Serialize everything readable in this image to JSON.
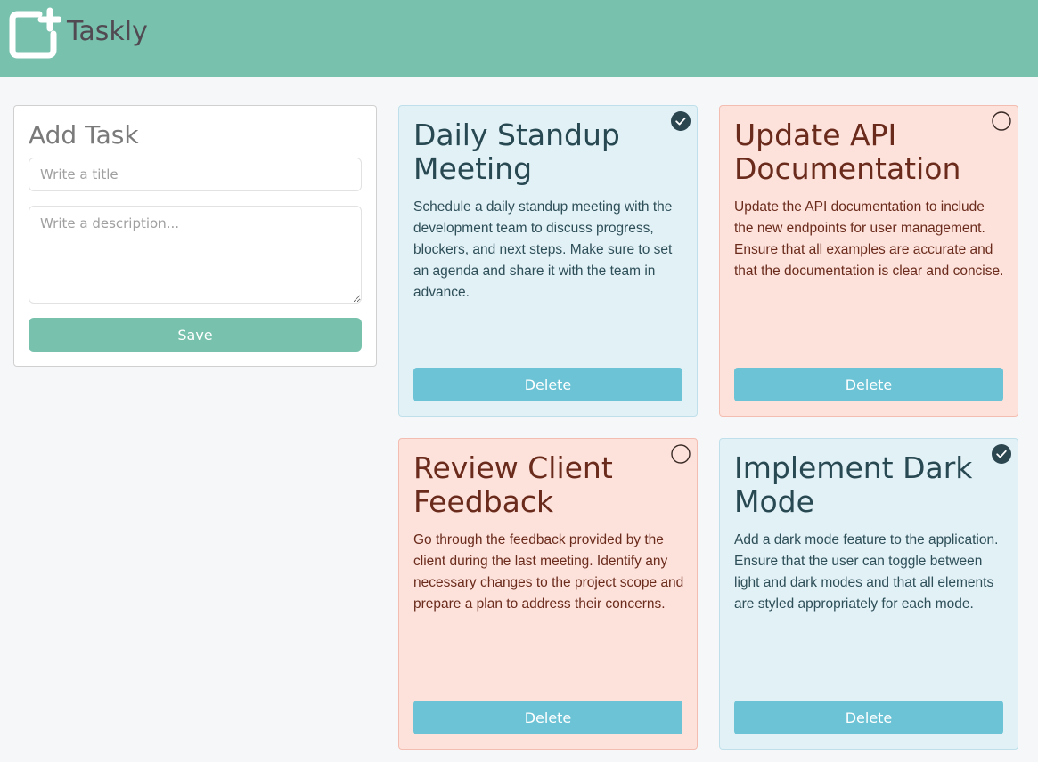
{
  "app": {
    "title": "Taskly",
    "brand_color": "#78c2ad",
    "logo_icon": "add-square-icon"
  },
  "add_task": {
    "heading": "Add Task",
    "title_placeholder": "Write a title",
    "title_value": "",
    "description_placeholder": "Write a description...",
    "description_value": "",
    "save_label": "Save"
  },
  "tasks": [
    {
      "title": "Daily Standup Meeting",
      "description": "Schedule a daily standup meeting with the development team to discuss progress, blockers, and next steps. Make sure to set an agenda and share it with the team in advance.",
      "completed": true,
      "theme": "blue",
      "delete_label": "Delete"
    },
    {
      "title": "Update API Documentation",
      "description": "Update the API documentation to include the new endpoints for user management. Ensure that all examples are accurate and that the documentation is clear and concise.",
      "completed": false,
      "theme": "red",
      "delete_label": "Delete"
    },
    {
      "title": "Review Client Feedback",
      "description": "Go through the feedback provided by the client during the last meeting. Identify any necessary changes to the project scope and prepare a plan to address their concerns.",
      "completed": false,
      "theme": "red",
      "delete_label": "Delete"
    },
    {
      "title": "Implement Dark Mode",
      "description": "Add a dark mode feature to the application. Ensure that the user can toggle between light and dark modes and that all elements are styled appropriately for each mode.",
      "completed": true,
      "theme": "blue",
      "delete_label": "Delete"
    }
  ],
  "colors": {
    "completed_card": "#e1f1f6",
    "pending_card": "#fde2db",
    "delete_button": "#6cc3d5",
    "check_filled": "#2c4650"
  }
}
